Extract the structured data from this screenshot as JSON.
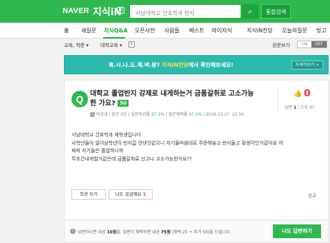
{
  "header": {
    "logo": "NAVER",
    "brand": "지식iN",
    "brand_mark": "iN",
    "search_placeholder": "서남대학교 간호학과 반지",
    "search_icon": "⌕",
    "total_search": "통합검색"
  },
  "nav": {
    "items": [
      "홈",
      "새질문",
      "지식Q&A",
      "오픈사전",
      "사람들",
      "베스트",
      "마이지식",
      "지식iN전당",
      "오늘의질문",
      "빙고"
    ],
    "active": "지식Q&A"
  },
  "breadcrumb": {
    "level1": "교육, 학문 ▾",
    "level2": "대학교육 ▾",
    "add": "+"
  },
  "original_view": {
    "label": "원문보기",
    "on": "ON",
    "off": "OFF"
  },
  "banner": {
    "prefix": "혹.시.나.도.체.벼.왕?",
    "highlight": "지식iN전당",
    "suffix": "에서 확인해보세요!",
    "button": "자세히보기 >"
  },
  "question": {
    "icon": "Q",
    "title": "대학교 졸업반지 강제로 내게하는거 금품갈취로 고소가능한 가요?",
    "points": "50",
    "author": "비공개",
    "meta_questions_label": "질문 0건",
    "meta_close_label": "질문마감률",
    "meta_close_value": "97.5%",
    "meta_adopt_label": "질문채택률",
    "meta_adopt_value": "97.5%",
    "date": "2016.12.07. 22:56",
    "likes": "0",
    "answers_label": "답변",
    "answers_value": "1",
    "views_label": "조회",
    "views_value": "87",
    "body": [
      "서남대학교 간호학과 재학생입니다",
      "사학년들이 일이삼학년이 반지값 안낸것같으니 자기들마음대로 주문해놓고 반지들고 횡생각인거같아요 어",
      "짜피 자기들은 졸업하니까",
      "무조건내게할거같은데 금품갈취로 신고나 고소가능한가요??"
    ],
    "opinion_button": "의견 쓰기",
    "curious_label": "나도 궁금해요",
    "curious_count": "1",
    "report": "신고"
  },
  "footer": {
    "info_icon": "!",
    "text_a": "답변하시면 내공",
    "points_a": "10점",
    "text_b": "을, 답변이 채택되면 내공",
    "points_b": "75점",
    "text_c": "(채택 25 + 추가 50)",
    "text_d": "을 드립니다.",
    "answer_button": "나도 답변하기"
  }
}
